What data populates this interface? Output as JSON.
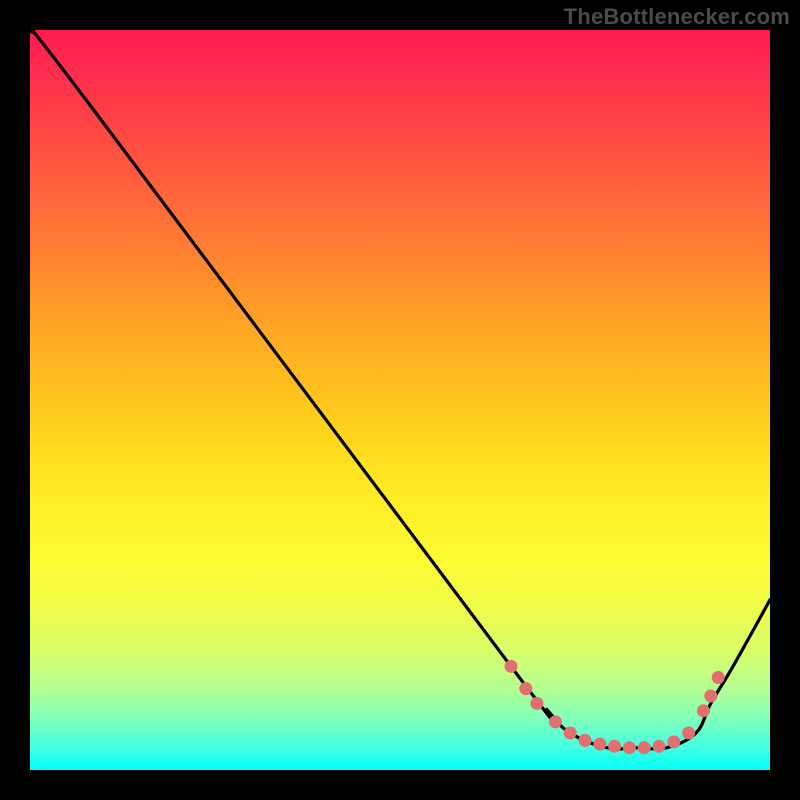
{
  "watermark": "TheBottleneсker.com",
  "chart_data": {
    "type": "line",
    "title": "",
    "xlabel": "",
    "ylabel": "",
    "xlim": [
      0,
      100
    ],
    "ylim": [
      0,
      100
    ],
    "background": "red-yellow-green vertical gradient (red top, green bottom)",
    "series": [
      {
        "name": "curve",
        "x": [
          0,
          8,
          65,
          70,
          73,
          78,
          82,
          86,
          90,
          92,
          95,
          100
        ],
        "y": [
          100,
          90,
          14,
          8,
          5,
          3,
          3,
          3,
          5,
          9,
          14,
          23
        ]
      }
    ],
    "markers": {
      "name": "highlight-points",
      "color": "#e36f6f",
      "points": [
        {
          "x": 65.0,
          "y": 14.0
        },
        {
          "x": 67.0,
          "y": 11.0
        },
        {
          "x": 68.5,
          "y": 9.0
        },
        {
          "x": 71.0,
          "y": 6.5
        },
        {
          "x": 73.0,
          "y": 5.0
        },
        {
          "x": 75.0,
          "y": 4.0
        },
        {
          "x": 77.0,
          "y": 3.5
        },
        {
          "x": 79.0,
          "y": 3.2
        },
        {
          "x": 81.0,
          "y": 3.0
        },
        {
          "x": 83.0,
          "y": 3.0
        },
        {
          "x": 85.0,
          "y": 3.2
        },
        {
          "x": 87.0,
          "y": 3.8
        },
        {
          "x": 89.0,
          "y": 5.0
        },
        {
          "x": 91.0,
          "y": 8.0
        },
        {
          "x": 92.0,
          "y": 10.0
        },
        {
          "x": 93.0,
          "y": 12.5
        }
      ]
    }
  }
}
